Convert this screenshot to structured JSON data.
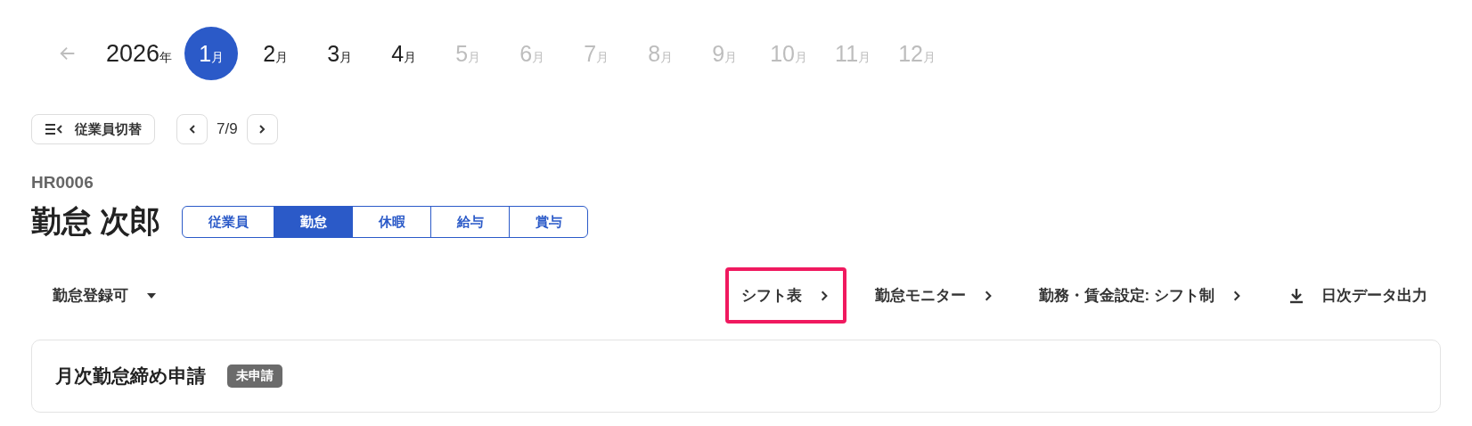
{
  "year_nav": {
    "year": "2026",
    "year_suffix": "年"
  },
  "months": [
    {
      "number": "1",
      "suffix": "月",
      "selected": true,
      "disabled": false
    },
    {
      "number": "2",
      "suffix": "月",
      "selected": false,
      "disabled": false
    },
    {
      "number": "3",
      "suffix": "月",
      "selected": false,
      "disabled": false
    },
    {
      "number": "4",
      "suffix": "月",
      "selected": false,
      "disabled": false
    },
    {
      "number": "5",
      "suffix": "月",
      "selected": false,
      "disabled": true
    },
    {
      "number": "6",
      "suffix": "月",
      "selected": false,
      "disabled": true
    },
    {
      "number": "7",
      "suffix": "月",
      "selected": false,
      "disabled": true
    },
    {
      "number": "8",
      "suffix": "月",
      "selected": false,
      "disabled": true
    },
    {
      "number": "9",
      "suffix": "月",
      "selected": false,
      "disabled": true
    },
    {
      "number": "10",
      "suffix": "月",
      "selected": false,
      "disabled": true
    },
    {
      "number": "11",
      "suffix": "月",
      "selected": false,
      "disabled": true
    },
    {
      "number": "12",
      "suffix": "月",
      "selected": false,
      "disabled": true
    }
  ],
  "employee_switch": {
    "label": "従業員切替"
  },
  "pager": {
    "text": "7/9"
  },
  "employee": {
    "code": "HR0006",
    "name": "勤怠 次郎"
  },
  "tabs": [
    {
      "label": "従業員",
      "selected": false
    },
    {
      "label": "勤怠",
      "selected": true
    },
    {
      "label": "休暇",
      "selected": false
    },
    {
      "label": "給与",
      "selected": false
    },
    {
      "label": "賞与",
      "selected": false
    }
  ],
  "status_dropdown": {
    "label": "勤怠登録可"
  },
  "links": [
    {
      "label": "シフト表",
      "kind": "link",
      "highlighted": true
    },
    {
      "label": "勤怠モニター",
      "kind": "link",
      "highlighted": false
    },
    {
      "label": "勤務・賃金設定: シフト制",
      "kind": "link",
      "highlighted": false
    },
    {
      "label": "日次データ出力",
      "kind": "download",
      "highlighted": false
    }
  ],
  "card": {
    "title": "月次勤怠締め申請",
    "badge": "未申請"
  }
}
